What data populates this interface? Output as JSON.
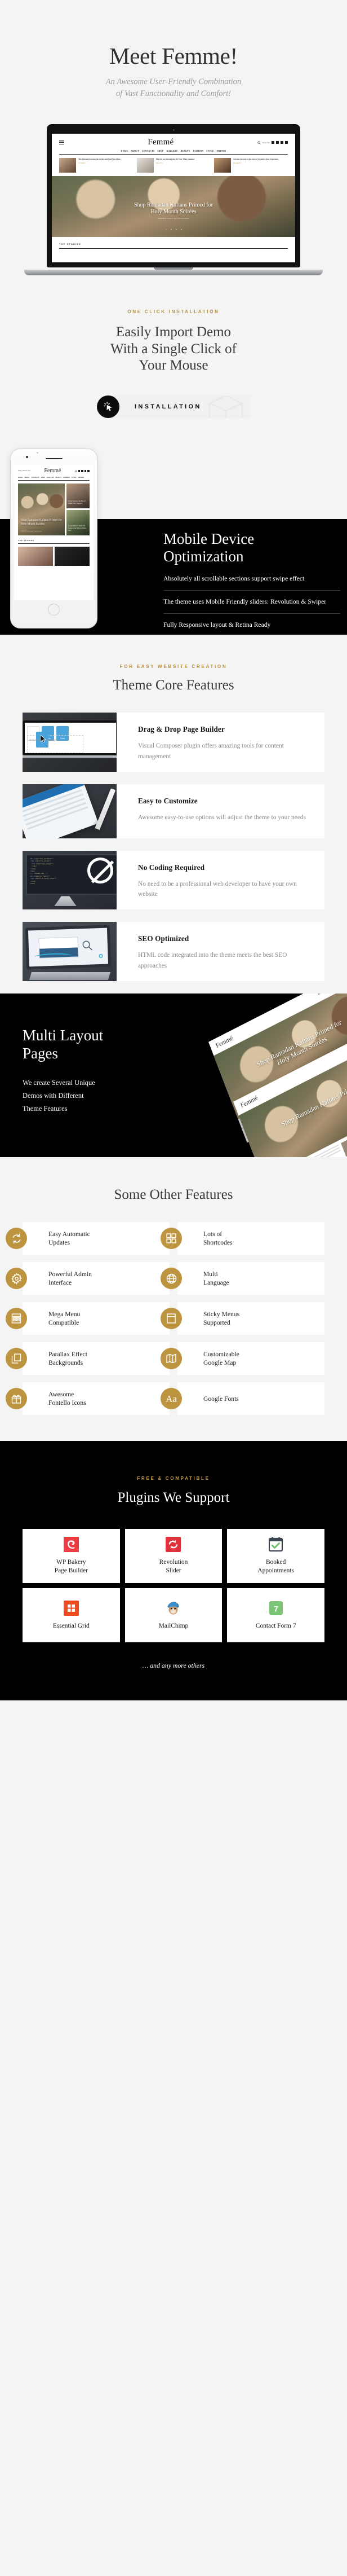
{
  "hero": {
    "title": "Meet Femme!",
    "subtitle_line1": "An Awesome User-Friendly Combination",
    "subtitle_line2": "of Vast Functionality  and Comfort!",
    "mockup": {
      "logo": "Femmé",
      "nav": [
        "HOME",
        "ABOUT",
        "CONTACTS",
        "SHOP",
        "GALLERY",
        "BEAUTY",
        "FASHION",
        "STYLE",
        "TRENDS"
      ],
      "subscribe_label": "Subscribe",
      "cards": [
        {
          "title": "The Anti-ox Dressing the Artist and Bold New Place",
          "category": "STORIES",
          "time": "2 hour ago"
        },
        {
          "title": "The 101 on Nursing the 70s Way Than Summer",
          "category": "BEAUTY",
          "time": "2 hours ago"
        },
        {
          "title": "Kristen Stewart is the Face of Chanel's New Fragrance",
          "category": "FASHION",
          "time": "4 hours ago"
        }
      ],
      "hero_title_line1": "Shop Ramadan Kaftans Primed for",
      "hero_title_line2": "Holy Month Soirées",
      "hero_meta": "FASHION    2 hours ago    Victoria Owen",
      "section_label": "TOP STORIES"
    }
  },
  "installation": {
    "eyebrow": "ONE CLICK INSTALLATION",
    "title_line1": "Easily Import Demo",
    "title_line2": "With a Single Click of",
    "title_line3": "Your Mouse",
    "button_label": "INSTALLATION",
    "button_icon": "cursor-click-icon"
  },
  "mobile": {
    "title_line1": "Mobile Device",
    "title_line2": "Optimization",
    "items": [
      "Absolutely all scrollable sections support swipe effect",
      "The theme uses Mobile Friendly sliders: Revolution & Swiper",
      "Fully Responsive layout & Retina Ready"
    ],
    "phone_mockup": {
      "date": "Today, June 20, 2017",
      "logo": "Femmé",
      "nav": [
        "HOME",
        "ABOUT",
        "CONTACTS",
        "SHOP",
        "GALLERY",
        "BEAUTY",
        "FASHION",
        "STYLE",
        "TRENDS"
      ],
      "hero_title": "Shop Ramadan Kaftans Primed for Holy Month Soirées",
      "hero_meta": "FASHION   2 hours ago   Victoria Owen",
      "side_titles": [
        "Kristen Stewart is the Face of Chanel's New Fragrance",
        "An Anti-Pollution Mask with Botanical Spa Herbs for Better Care"
      ],
      "section_label": "TOP STORIES"
    }
  },
  "core": {
    "eyebrow": "FOR EASY WEBSITE CREATION",
    "title": "Theme Core Features",
    "cards": [
      {
        "title": "Drag & Drop Page  Builder",
        "text": "Visual  Composer plugin offers amazing tools for content management",
        "thumb": "drag-drop-builder-thumb",
        "thumb_caption": "Drag here to add widgets",
        "tiles": [
          "Sliders",
          "Forms",
          "Posts"
        ]
      },
      {
        "title": "Easy to Customize",
        "text": "Awesome easy-to-use options will adjust the theme to your needs",
        "thumb": "tablet-stylus-thumb"
      },
      {
        "title": "No Coding Required",
        "text": "No need to be a professional web developer to have your own website",
        "thumb": "imac-code-thumb"
      },
      {
        "title": "SEO Optimized",
        "text": "HTML code integrated into the theme meets the best SEO approaches",
        "thumb": "tablet-seo-thumb"
      }
    ]
  },
  "multi": {
    "title_line1": "Multi Layout",
    "title_line2": "Pages",
    "text_line1": "We create Several Unique",
    "text_line2": "Demos with Different",
    "text_line3": "Theme Features",
    "mockup_logo": "Femmé",
    "mockup_hero_line1": "Shop Ramadan Kaftans Primed for",
    "mockup_hero_line2": "Holy Month Soirées"
  },
  "other": {
    "title": "Some Other Features",
    "features": [
      {
        "label_line1": "Easy Automatic",
        "label_line2": "Updates",
        "icon": "refresh-icon"
      },
      {
        "label_line1": "Lots of",
        "label_line2": "Shortcodes",
        "icon": "grid-blocks-icon"
      },
      {
        "label_line1": "Powerful Admin",
        "label_line2": "Interface",
        "icon": "gear-icon"
      },
      {
        "label_line1": "Multi",
        "label_line2": "Language",
        "icon": "globe-icon"
      },
      {
        "label_line1": "Mega Menu",
        "label_line2": "Compatible",
        "icon": "mega-menu-icon"
      },
      {
        "label_line1": "Sticky Menus",
        "label_line2": "Supported",
        "icon": "sticky-menu-icon"
      },
      {
        "label_line1": "Parallax Effect",
        "label_line2": "Backgrounds",
        "icon": "layers-icon"
      },
      {
        "label_line1": "Customizable",
        "label_line2": "Google Map",
        "icon": "map-icon"
      },
      {
        "label_line1": "Awesome",
        "label_line2": "Fontello Icons",
        "icon": "gift-icon"
      },
      {
        "label_line1": "Google Fonts",
        "label_line2": "",
        "icon": "typography-aa-icon"
      }
    ]
  },
  "plugins": {
    "eyebrow": "FREE & COMPATIBLE",
    "title": "Plugins We Support",
    "items": [
      {
        "label_line1": "WP Bakery",
        "label_line2": "Page Builder",
        "icon": "wpbakery-icon",
        "color": "#ee3b42"
      },
      {
        "label_line1": "Revolution",
        "label_line2": "Slider",
        "icon": "revolution-slider-icon",
        "color": "#e0323c"
      },
      {
        "label_line1": "Booked",
        "label_line2": "Appointments",
        "icon": "booked-calendar-icon",
        "color": "#3b4552"
      },
      {
        "label_line1": "Essential Grid",
        "label_line2": "",
        "icon": "essential-grid-icon",
        "color": "#ee4c1e"
      },
      {
        "label_line1": "MailChimp",
        "label_line2": "",
        "icon": "mailchimp-monkey-icon",
        "color": "#2c9ad6"
      },
      {
        "label_line1": "Contact Form 7",
        "label_line2": "",
        "icon": "contact-form-7-icon",
        "color": "#7cc576"
      }
    ],
    "footer_note": "… and any more others"
  },
  "colors": {
    "accent_gold": "#bd9440",
    "dark": "#000000",
    "light_bg": "#f4f4f4",
    "text": "#2b2b2b",
    "muted": "#8a8a8a"
  }
}
